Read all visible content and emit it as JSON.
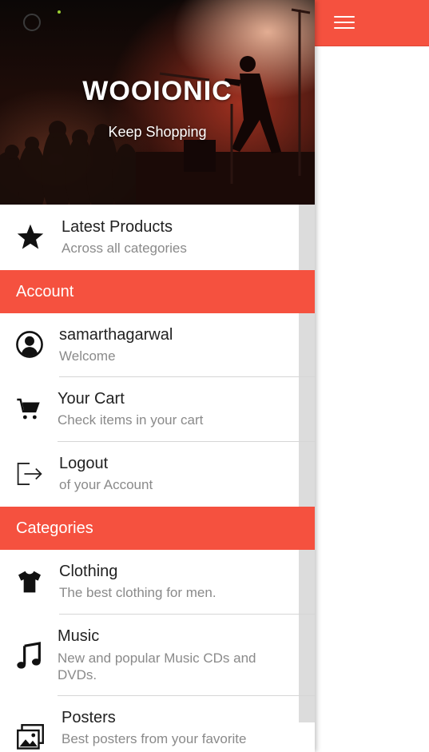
{
  "app": {
    "brand": "WOOIONIC",
    "tagline": "Keep Shopping",
    "accent_color": "#f5513f"
  },
  "toolbar": {
    "menu_icon": "hamburger-menu-icon"
  },
  "menu": {
    "latest": {
      "title": "Latest Products",
      "subtitle": "Across all categories",
      "icon": "star-icon"
    },
    "account_header": "Account",
    "account_items": [
      {
        "title": "samarthagarwal",
        "subtitle": "Welcome",
        "icon": "user-avatar-icon"
      },
      {
        "title": "Your Cart",
        "subtitle": "Check items in your cart",
        "icon": "cart-icon"
      },
      {
        "title": "Logout",
        "subtitle": "of your Account",
        "icon": "logout-icon"
      }
    ],
    "categories_header": "Categories",
    "category_items": [
      {
        "title": "Clothing",
        "subtitle": "The best clothing for men.",
        "icon": "tshirt-icon"
      },
      {
        "title": "Music",
        "subtitle": "New and popular Music CDs and DVDs.",
        "icon": "music-note-icon"
      },
      {
        "title": "Posters",
        "subtitle": "Best posters from your favorite",
        "icon": "images-icon"
      }
    ]
  }
}
